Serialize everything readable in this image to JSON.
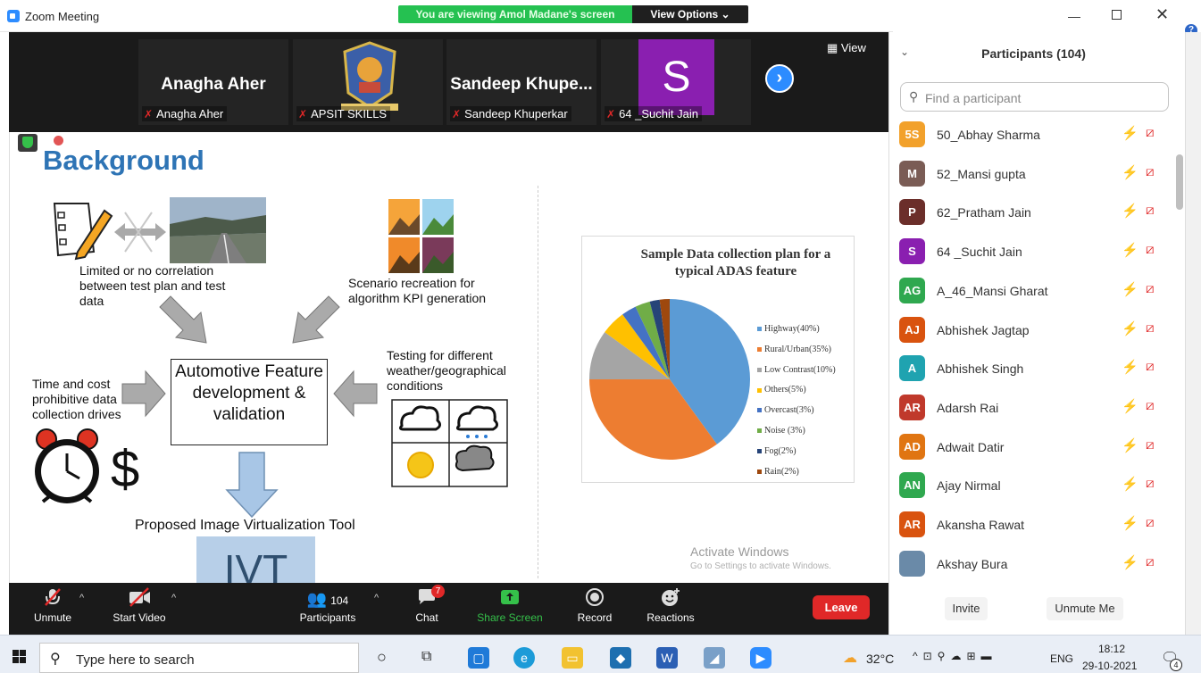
{
  "window": {
    "title": "Zoom Meeting"
  },
  "banner": {
    "text": "You are viewing Amol Madane's screen",
    "view_options": "View Options ⌄"
  },
  "gallery": {
    "tiles": [
      {
        "display_name": "Anagha Aher",
        "label": "Anagha Aher"
      },
      {
        "display_name": "",
        "label": "APSIT SKILLS"
      },
      {
        "display_name": "Sandeep  Khupe...",
        "label": "Sandeep Khuperkar"
      },
      {
        "display_name": "",
        "label": "64 _Suchit Jain"
      }
    ],
    "avatar_letter": "S",
    "view_label": "View"
  },
  "slide": {
    "title": "Background",
    "text_limited": "Limited or no correlation between test plan and test data",
    "text_scenario": "Scenario recreation for algorithm KPI generation",
    "text_time_cost": "Time and cost prohibitive data collection drives",
    "text_testing": "Testing for different weather/geographical conditions",
    "center_box": "Automotive Feature development & validation",
    "proposed": "Proposed Image Virtualization Tool",
    "ivt": "IVT",
    "dollar": "$"
  },
  "chart_data": {
    "type": "pie",
    "title": "Sample Data collection plan for a typical ADAS feature",
    "categories": [
      "Highway(40%)",
      "Rural/Urban(35%)",
      "Low Contrast(10%)",
      "Others(5%)",
      "Overcast(3%)",
      "Noise (3%)",
      "Fog(2%)",
      "Rain(2%)"
    ],
    "values": [
      40,
      35,
      10,
      5,
      3,
      3,
      2,
      2
    ],
    "colors": [
      "#5b9bd5",
      "#ed7d31",
      "#a5a5a5",
      "#ffc000",
      "#4472c4",
      "#70ad47",
      "#264478",
      "#9e480e"
    ],
    "legend_position": "right"
  },
  "watermark": {
    "line1": "Activate Windows",
    "line2": "Go to Settings to activate Windows."
  },
  "controls": {
    "unmute": "Unmute",
    "start_video": "Start Video",
    "participants": "Participants",
    "participants_count": "104",
    "chat": "Chat",
    "chat_badge": "7",
    "share_screen": "Share Screen",
    "record": "Record",
    "reactions": "Reactions",
    "leave": "Leave"
  },
  "panel": {
    "title": "Participants (104)",
    "search_placeholder": "Find a participant",
    "invite": "Invite",
    "unmute_me": "Unmute Me",
    "participants": [
      {
        "initials": "5S",
        "name": "50_Abhay Sharma",
        "color": "#f2a12b"
      },
      {
        "initials": "M",
        "name": "52_Mansi gupta",
        "color": "#7a5c55"
      },
      {
        "initials": "P",
        "name": "62_Pratham Jain",
        "color": "#6b2e2a"
      },
      {
        "initials": "S",
        "name": "64 _Suchit Jain",
        "color": "#8a1fb0"
      },
      {
        "initials": "AG",
        "name": "A_46_Mansi Gharat",
        "color": "#2fa84f"
      },
      {
        "initials": "AJ",
        "name": "Abhishek Jagtap",
        "color": "#d9530f"
      },
      {
        "initials": "A",
        "name": "Abhishek Singh",
        "color": "#1fa3b0"
      },
      {
        "initials": "AR",
        "name": "Adarsh Rai",
        "color": "#c0392b"
      },
      {
        "initials": "AD",
        "name": "Adwait Datir",
        "color": "#e07512"
      },
      {
        "initials": "AN",
        "name": "Ajay Nirmal",
        "color": "#2fa84f"
      },
      {
        "initials": "AR",
        "name": "Akansha Rawat",
        "color": "#d9530f"
      },
      {
        "initials": "",
        "name": "Akshay Bura",
        "color": "#6a8aa8"
      }
    ]
  },
  "taskbar": {
    "search_text": "Type here to search",
    "temperature": "32°C",
    "language": "ENG",
    "time": "18:12",
    "date": "29-10-2021",
    "notification_count": "4"
  }
}
